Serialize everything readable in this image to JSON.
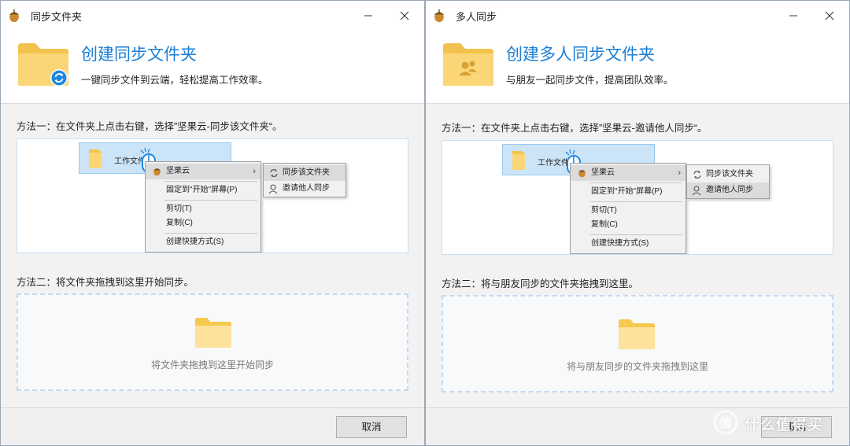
{
  "colors": {
    "accent": "#1b7ed6",
    "folder": "#fbd676",
    "folder_back": "#f2c24e",
    "sync_badge": "#1f86e0"
  },
  "left_window": {
    "title": "同步文件夹",
    "header": {
      "title": "创建同步文件夹",
      "subtitle": "一键同步文件到云端，轻松提高工作效率。",
      "badge_icon": "sync-icon"
    },
    "method1": {
      "label": "方法一：在文件夹上点击右键，选择”坚果云-同步该文件夹“。",
      "file_label": "工作文件夹",
      "menu": {
        "items": [
          "坚果云",
          "固定到\"开始\"屏幕(P)",
          "剪切(T)",
          "复制(C)",
          "创建快捷方式(S)"
        ]
      },
      "submenu": {
        "items": [
          "同步该文件夹",
          "邀请他人同步"
        ],
        "highlighted": 0
      }
    },
    "method2": {
      "label": "方法二：将文件夹拖拽到这里开始同步。",
      "drop_text": "将文件夹拖拽到这里开始同步"
    },
    "footer": {
      "cancel_label": "取消"
    }
  },
  "right_window": {
    "title": "多人同步",
    "header": {
      "title": "创建多人同步文件夹",
      "subtitle": "与朋友一起同步文件，提高团队效率。",
      "badge_icon": "people-icon"
    },
    "method1": {
      "label": "方法一：在文件夹上点击右键，选择”坚果云-邀请他人同步“。",
      "file_label": "工作文件夹",
      "menu": {
        "items": [
          "坚果云",
          "固定到\"开始\"屏幕(P)",
          "剪切(T)",
          "复制(C)",
          "创建快捷方式(S)"
        ]
      },
      "submenu": {
        "items": [
          "同步该文件夹",
          "邀请他人同步"
        ],
        "highlighted": 1
      }
    },
    "method2": {
      "label": "方法二：将与朋友同步的文件夹拖拽到这里。",
      "drop_text": "将与朋友同步的文件夹拖拽到这里"
    },
    "footer": {
      "cancel_label": "取消"
    }
  },
  "watermark": {
    "text": "什么值得买"
  }
}
